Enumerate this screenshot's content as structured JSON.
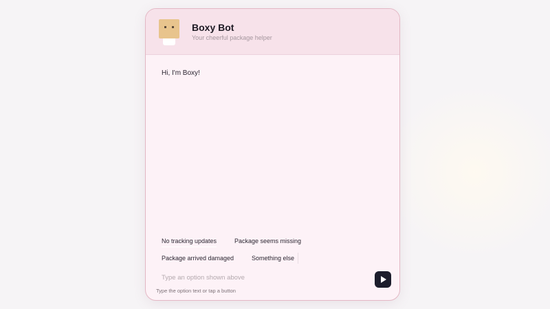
{
  "bot": {
    "name": "Boxy Bot",
    "tagline": "Your cheerful package helper",
    "avatar_icon": "box-robot-icon"
  },
  "messages": [
    {
      "from": "bot",
      "text": "Hi, I'm Boxy!"
    }
  ],
  "options": [
    {
      "label": "No tracking updates"
    },
    {
      "label": "Package seems missing"
    },
    {
      "label": "Package arrived damaged"
    },
    {
      "label": "Something else"
    }
  ],
  "input": {
    "placeholder": "Type an option shown above",
    "value": ""
  },
  "send": {
    "icon": "send-arrow-icon"
  },
  "hint": "Type the option text or tap a button",
  "colors": {
    "card_background": "#fdf2f7",
    "header_background": "#f7e2ea",
    "card_border": "#e3b7c4",
    "send_button": "#1c1d2c"
  }
}
